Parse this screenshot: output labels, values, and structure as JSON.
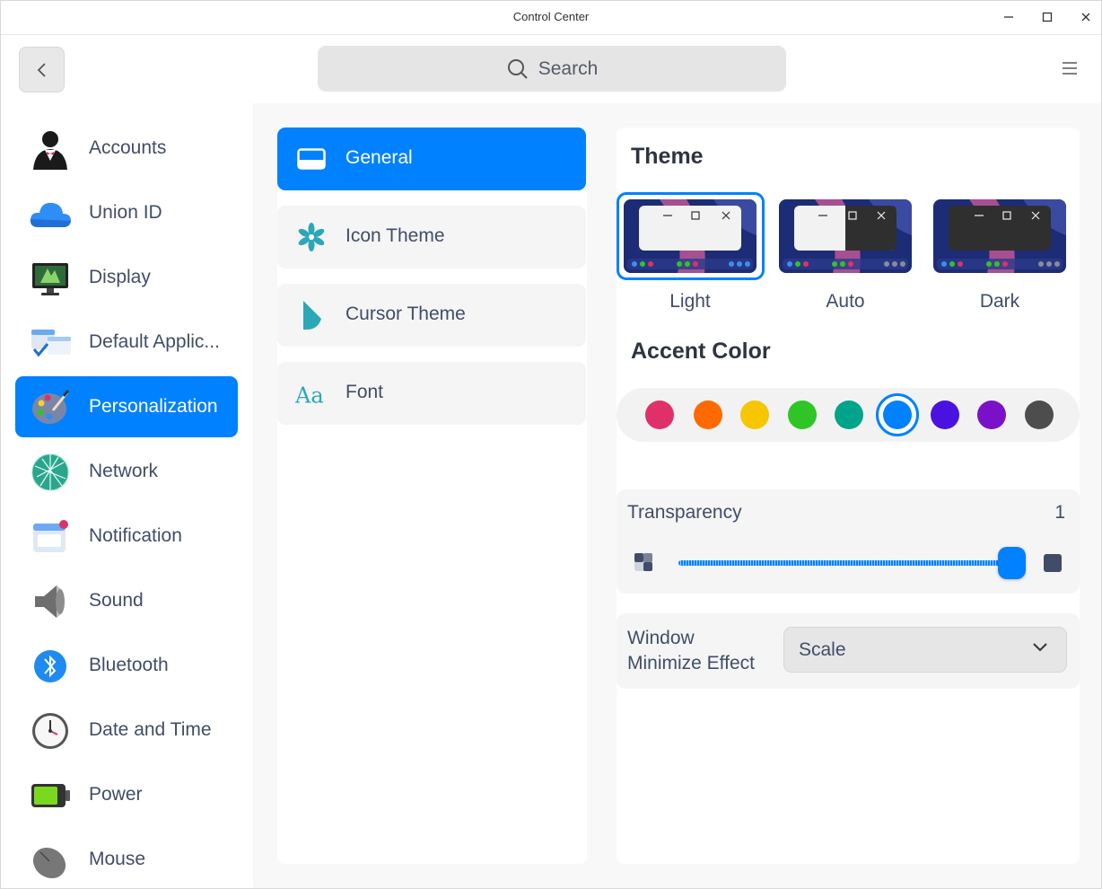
{
  "window": {
    "title": "Control Center"
  },
  "toolbar": {
    "search_label": "Search"
  },
  "sidebar": {
    "items": [
      {
        "label": "Accounts",
        "icon": "accounts-icon"
      },
      {
        "label": "Union ID",
        "icon": "cloud-icon"
      },
      {
        "label": "Display",
        "icon": "display-icon"
      },
      {
        "label": "Default Applic...",
        "icon": "default-apps-icon"
      },
      {
        "label": "Personalization",
        "icon": "palette-icon"
      },
      {
        "label": "Network",
        "icon": "network-icon"
      },
      {
        "label": "Notification",
        "icon": "notification-icon"
      },
      {
        "label": "Sound",
        "icon": "speaker-icon"
      },
      {
        "label": "Bluetooth",
        "icon": "bluetooth-icon"
      },
      {
        "label": "Date and Time",
        "icon": "clock-icon"
      },
      {
        "label": "Power",
        "icon": "battery-icon"
      },
      {
        "label": "Mouse",
        "icon": "mouse-icon"
      }
    ],
    "active": "Personalization"
  },
  "subnav": {
    "items": [
      {
        "label": "General",
        "icon": "window-icon"
      },
      {
        "label": "Icon Theme",
        "icon": "snowflake-icon"
      },
      {
        "label": "Cursor Theme",
        "icon": "cursor-icon"
      },
      {
        "label": "Font",
        "icon": "font-icon"
      }
    ],
    "active": "General"
  },
  "general": {
    "theme_title": "Theme",
    "themes": [
      {
        "label": "Light",
        "selected": true
      },
      {
        "label": "Auto",
        "selected": false
      },
      {
        "label": "Dark",
        "selected": false
      }
    ],
    "accent_title": "Accent Color",
    "accent_colors": [
      "#e0306a",
      "#ff6a00",
      "#f7c600",
      "#2ec526",
      "#00a48a",
      "#0081ff",
      "#4a12e0",
      "#7a11c9",
      "#4d4d4d"
    ],
    "accent_selected": "#0081ff",
    "transparency_label": "Transparency",
    "transparency_value": "1",
    "transparency_level": 0.96,
    "minimize_label_line1": "Window",
    "minimize_label_line2": "Minimize Effect",
    "minimize_value": "Scale"
  },
  "colors": {
    "accent": "#0081ff",
    "text": "#414d68"
  }
}
